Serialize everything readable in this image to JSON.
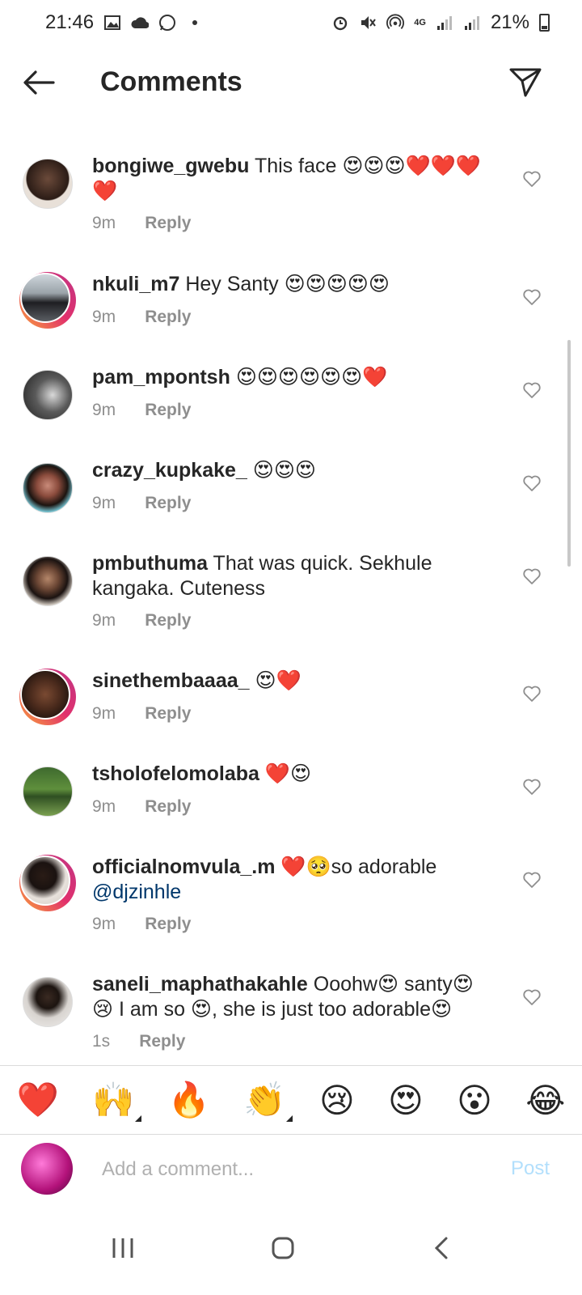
{
  "status_bar": {
    "time": "21:46",
    "network": "4G",
    "battery": "21%"
  },
  "header": {
    "title": "Comments"
  },
  "comments": [
    {
      "username": "bongiwe_gwebu",
      "text": "This face 😍😍😍❤️❤️❤️❤️",
      "time": "9m",
      "reply": "Reply"
    },
    {
      "username": "nkuli_m7",
      "text": "Hey Santy 😍😍😍😍😍",
      "time": "9m",
      "reply": "Reply"
    },
    {
      "username": "pam_mpontsh",
      "text": "😍😍😍😍😍😍❤️",
      "time": "9m",
      "reply": "Reply"
    },
    {
      "username": "crazy_kupkake_",
      "text": "😍😍😍",
      "time": "9m",
      "reply": "Reply"
    },
    {
      "username": "pmbuthuma",
      "text": "That was quick. Sekhule kangaka. Cuteness",
      "time": "9m",
      "reply": "Reply"
    },
    {
      "username": "sinethembaaaa_",
      "text": "😍❤️",
      "time": "9m",
      "reply": "Reply"
    },
    {
      "username": "tsholofelomolaba",
      "text": "❤️😍",
      "time": "9m",
      "reply": "Reply"
    },
    {
      "username": "officialnomvula_.m",
      "text": "❤️🥺so adorable",
      "mention": "@djzinhle",
      "time": "9m",
      "reply": "Reply"
    },
    {
      "username": "saneli_maphathakahle",
      "text": "Ooohw😍 santy😍 😢 I am so 😍, she is just too adorable😍",
      "time": "1s",
      "reply": "Reply"
    }
  ],
  "quick_reactions": [
    "❤️",
    "🙌",
    "🔥",
    "👏",
    "😢",
    "😍",
    "😮",
    "😂"
  ],
  "composer": {
    "placeholder": "Add a comment...",
    "post_label": "Post"
  }
}
